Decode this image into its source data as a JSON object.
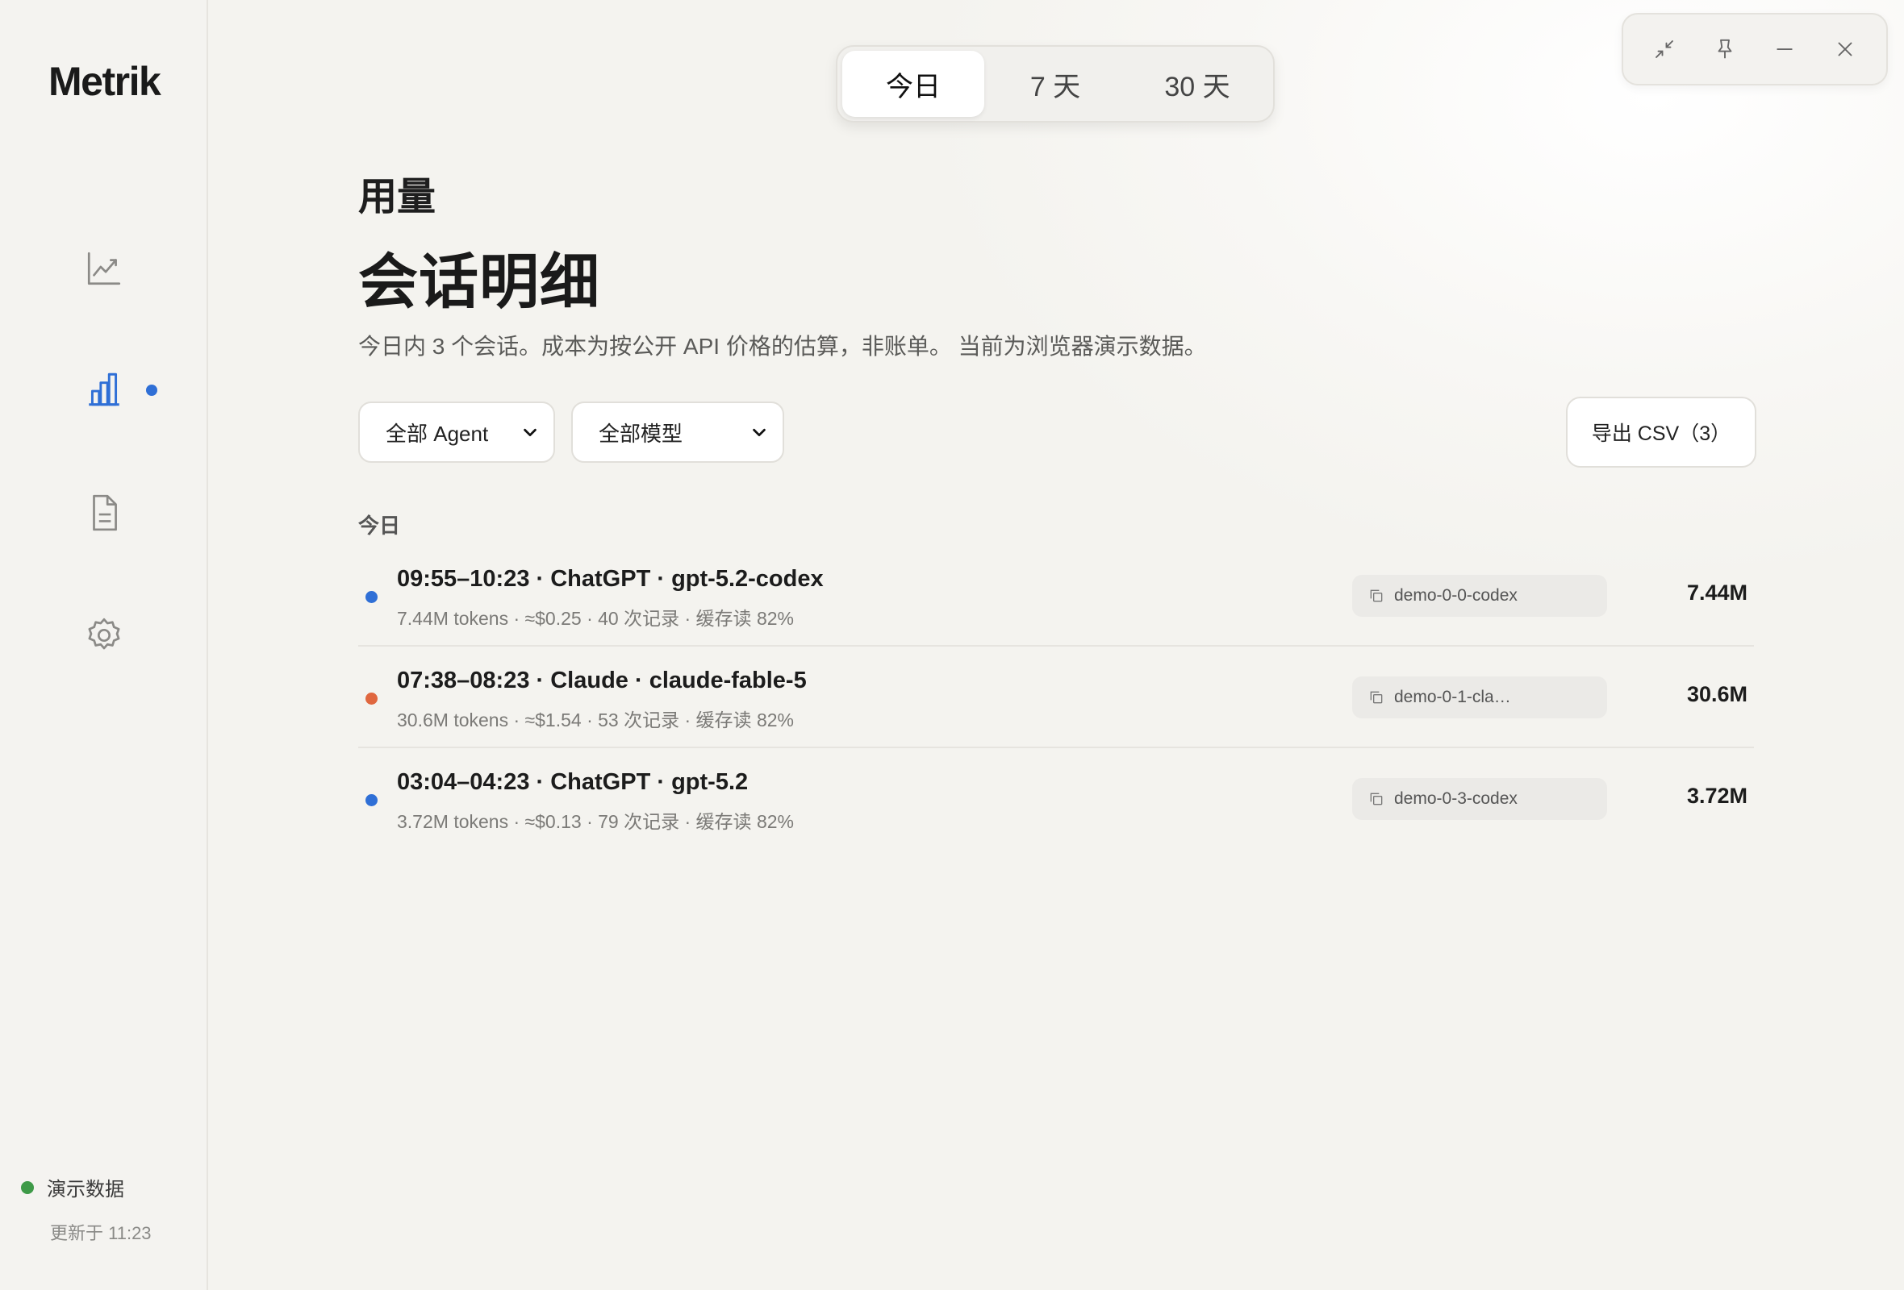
{
  "app": {
    "brand": "Metrik"
  },
  "nav": {
    "items": [
      {
        "name": "trend",
        "icon": "trend-line-icon",
        "active": false
      },
      {
        "name": "usage",
        "icon": "bar-chart-icon",
        "active": true
      },
      {
        "name": "reports",
        "icon": "document-icon",
        "active": false
      },
      {
        "name": "settings",
        "icon": "gear-icon",
        "active": false
      }
    ],
    "status_label": "演示数据",
    "updated_label": "更新于 11:23"
  },
  "range_tabs": [
    {
      "label": "今日",
      "active": true
    },
    {
      "label": "7 天",
      "active": false
    },
    {
      "label": "30 天",
      "active": false
    }
  ],
  "header": {
    "section": "用量",
    "title": "会话明细",
    "subtitle": "今日内 3 个会话。成本为按公开 API 价格的估算，非账单。 当前为浏览器演示数据。"
  },
  "filters": {
    "agent": "全部 Agent",
    "model": "全部模型",
    "export_label": "导出 CSV（3）"
  },
  "group": {
    "label": "今日"
  },
  "sessions": [
    {
      "title": "09:55–10:23 · ChatGPT · gpt-5.2-codex",
      "meta": "7.44M tokens · ≈$0.25 · 40 次记录 · 缓存读 82%",
      "id": "demo-0-0-codex",
      "amount": "7.44M",
      "color": "#2f6fd6"
    },
    {
      "title": "07:38–08:23 · Claude · claude-fable-5",
      "meta": "30.6M tokens · ≈$1.54 · 53 次记录 · 缓存读 82%",
      "id": "demo-0-1-cla…",
      "amount": "30.6M",
      "color": "#e0673f"
    },
    {
      "title": "03:04–04:23 · ChatGPT · gpt-5.2",
      "meta": "3.72M tokens · ≈$0.13 · 79 次记录 · 缓存读 82%",
      "id": "demo-0-3-codex",
      "amount": "3.72M",
      "color": "#2f6fd6"
    }
  ],
  "colors": {
    "accent": "#2f6fd6",
    "claude": "#e0673f",
    "status_ok": "#3e9a48"
  }
}
